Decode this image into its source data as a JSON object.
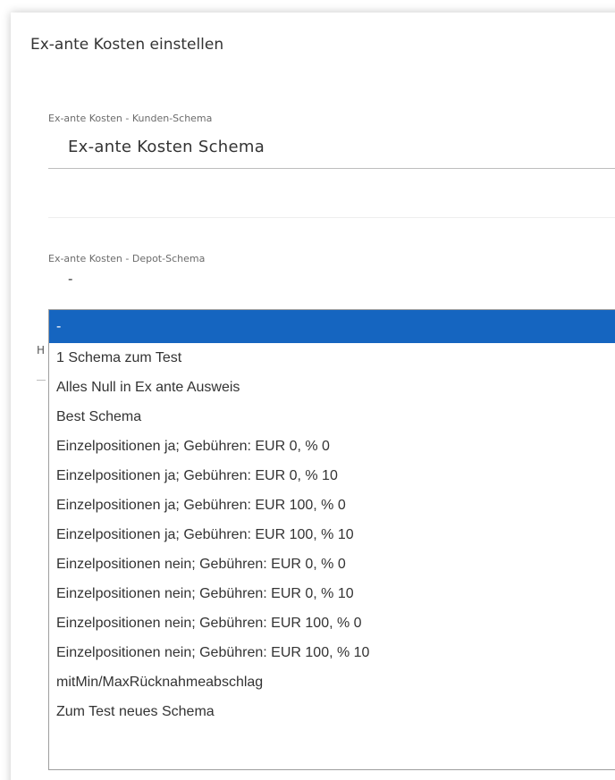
{
  "dialog": {
    "title": "Ex-ante Kosten einstellen"
  },
  "kunden_schema": {
    "label": "Ex-ante Kosten - Kunden-Schema",
    "value": "Ex-ante Kosten Schema"
  },
  "depot_schema": {
    "label": "Ex-ante Kosten - Depot-Schema",
    "value": "-",
    "options": [
      {
        "label": "-",
        "selected": true
      },
      {
        "label": "1 Schema zum Test",
        "selected": false
      },
      {
        "label": "Alles Null in Ex ante Ausweis",
        "selected": false
      },
      {
        "label": "Best Schema",
        "selected": false
      },
      {
        "label": "Einzelpositionen ja; Gebühren: EUR 0, % 0",
        "selected": false
      },
      {
        "label": "Einzelpositionen ja; Gebühren: EUR 0, % 10",
        "selected": false
      },
      {
        "label": "Einzelpositionen ja; Gebühren: EUR 100, % 0",
        "selected": false
      },
      {
        "label": "Einzelpositionen ja; Gebühren: EUR 100, % 10",
        "selected": false
      },
      {
        "label": "Einzelpositionen nein; Gebühren: EUR 0, % 0",
        "selected": false
      },
      {
        "label": "Einzelpositionen nein; Gebühren: EUR 0, % 10",
        "selected": false
      },
      {
        "label": "Einzelpositionen nein; Gebühren: EUR 100, % 0",
        "selected": false
      },
      {
        "label": "Einzelpositionen nein; Gebühren: EUR 100, % 10",
        "selected": false
      },
      {
        "label": "mitMin/MaxRücknahmeabschlag",
        "selected": false
      },
      {
        "label": "Zum Test neues Schema",
        "selected": false
      }
    ]
  },
  "hidden_field_hint": "H",
  "colors": {
    "selected_background": "#1565c0",
    "selected_text": "#ffffff",
    "text": "#333333"
  }
}
